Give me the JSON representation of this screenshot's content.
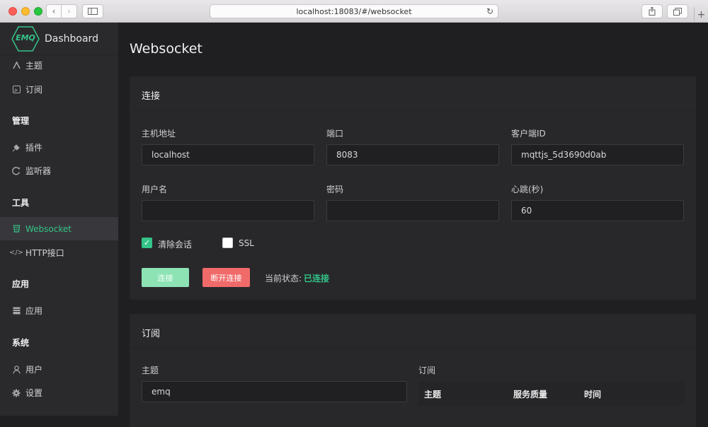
{
  "browser": {
    "url": "localhost:18083/#/websocket",
    "back_icon": "chevron-left-icon",
    "forward_icon": "chevron-right-icon",
    "new_tab": "+"
  },
  "sidebar": {
    "logo_text": "EMQ",
    "brand": "Dashboard",
    "items": [
      {
        "label": "主题",
        "icon": "topic-icon"
      },
      {
        "label": "订阅",
        "icon": "subscribe-icon"
      }
    ],
    "groups": [
      {
        "title": "管理",
        "items": [
          {
            "label": "插件",
            "icon": "plugin-icon"
          },
          {
            "label": "监听器",
            "icon": "listener-icon"
          }
        ]
      },
      {
        "title": "工具",
        "items": [
          {
            "label": "Websocket",
            "icon": "websocket-icon",
            "active": true
          },
          {
            "label": "HTTP接口",
            "icon": "code-icon"
          }
        ]
      },
      {
        "title": "应用",
        "items": [
          {
            "label": "应用",
            "icon": "app-icon"
          }
        ]
      },
      {
        "title": "系统",
        "items": [
          {
            "label": "用户",
            "icon": "user-icon"
          },
          {
            "label": "设置",
            "icon": "gear-icon"
          }
        ]
      }
    ]
  },
  "main": {
    "title": "Websocket",
    "connect": {
      "title": "连接",
      "host_label": "主机地址",
      "host_value": "localhost",
      "port_label": "端口",
      "port_value": "8083",
      "client_label": "客户端ID",
      "client_value": "mqttjs_5d3690d0ab",
      "user_label": "用户名",
      "user_value": "",
      "pass_label": "密码",
      "pass_value": "",
      "keepalive_label": "心跳(秒)",
      "keepalive_value": "60",
      "clean_label": "清除会话",
      "clean_checked": true,
      "ssl_label": "SSL",
      "ssl_checked": false,
      "connect_btn": "连接",
      "disconnect_btn": "断开连接",
      "status_label": "当前状态:",
      "status_value": "已连接"
    },
    "subscribe": {
      "title": "订阅",
      "topic_label": "主题",
      "topic_value": "emq",
      "list_label": "订阅",
      "columns": [
        "主题",
        "服务质量",
        "时间"
      ]
    }
  },
  "colors": {
    "accent": "#34c388",
    "danger": "#f16a6a",
    "sidebar_bg": "#2a2a2d",
    "main_bg": "#1f1f22",
    "card_bg": "#28282b"
  }
}
